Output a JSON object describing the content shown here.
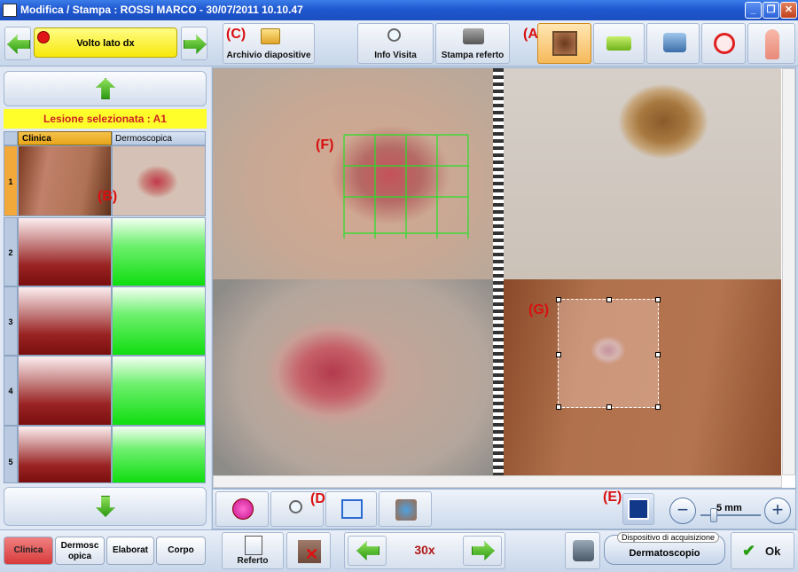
{
  "window": {
    "title": "Modifica / Stampa : ROSSI MARCO - 30/07/2011 10.10.47"
  },
  "toolbar": {
    "location_label": "Volto lato dx",
    "archive_label": "Archivio diapositive",
    "info_label": "Info Visita",
    "print_label": "Stampa referto"
  },
  "annotations": {
    "a": "(A)",
    "b": "(B)",
    "c": "(C)",
    "d": "(D)",
    "e": "(E)",
    "f": "(F)",
    "g": "(G)"
  },
  "left": {
    "selected_lesion": "Lesione selezionata : A1",
    "col_clinical": "Clinica",
    "col_dermo": "Dermoscopica",
    "rows": [
      "1",
      "2",
      "3",
      "4",
      "5"
    ]
  },
  "bottom_tabs": [
    "Clinica",
    "Dermosc opica",
    "Elaborat",
    "Corpo"
  ],
  "bottom": {
    "report_label": "Referto",
    "zoom": "30x",
    "device_caption": "Dispositivo di acquisizione",
    "device_name": "Dermatoscopio",
    "ok_label": "Ok"
  },
  "scale": {
    "value": "5 mm"
  }
}
